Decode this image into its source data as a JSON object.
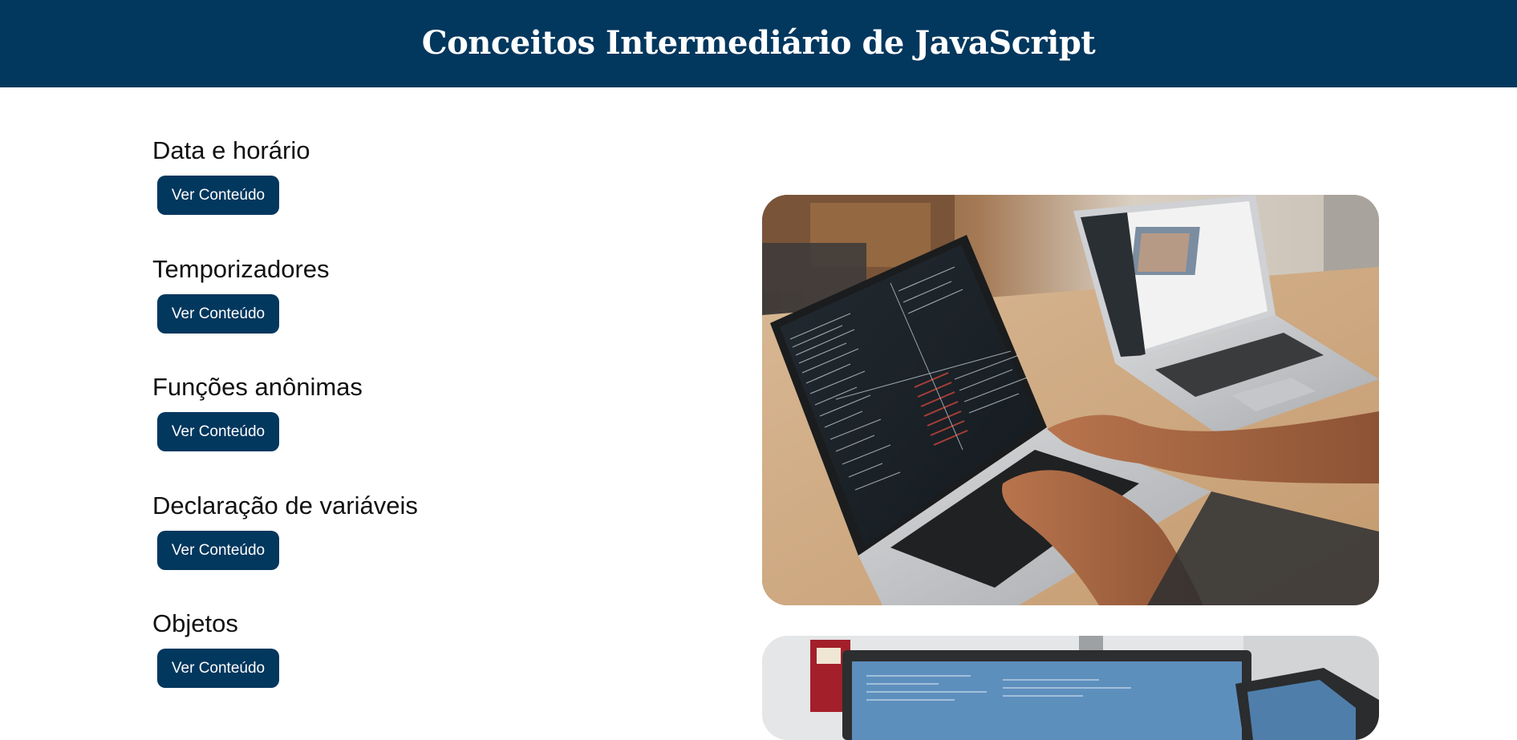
{
  "header": {
    "title": "Conceitos Intermediário de JavaScript"
  },
  "topics": [
    {
      "title": "Data e horário",
      "button_label": "Ver Conteúdo"
    },
    {
      "title": "Temporizadores",
      "button_label": "Ver Conteúdo"
    },
    {
      "title": "Funções anônimas",
      "button_label": "Ver Conteúdo"
    },
    {
      "title": "Declaração de variáveis",
      "button_label": "Ver Conteúdo"
    },
    {
      "title": "Objetos",
      "button_label": "Ver Conteúdo"
    }
  ],
  "colors": {
    "brand": "#02375e",
    "background": "#ffffff",
    "text": "#111111"
  },
  "images": [
    {
      "depicts": "hands typing on laptops with code",
      "icon": "laptop-photo"
    },
    {
      "depicts": "desktop monitors with code editor",
      "icon": "monitor-photo"
    }
  ]
}
